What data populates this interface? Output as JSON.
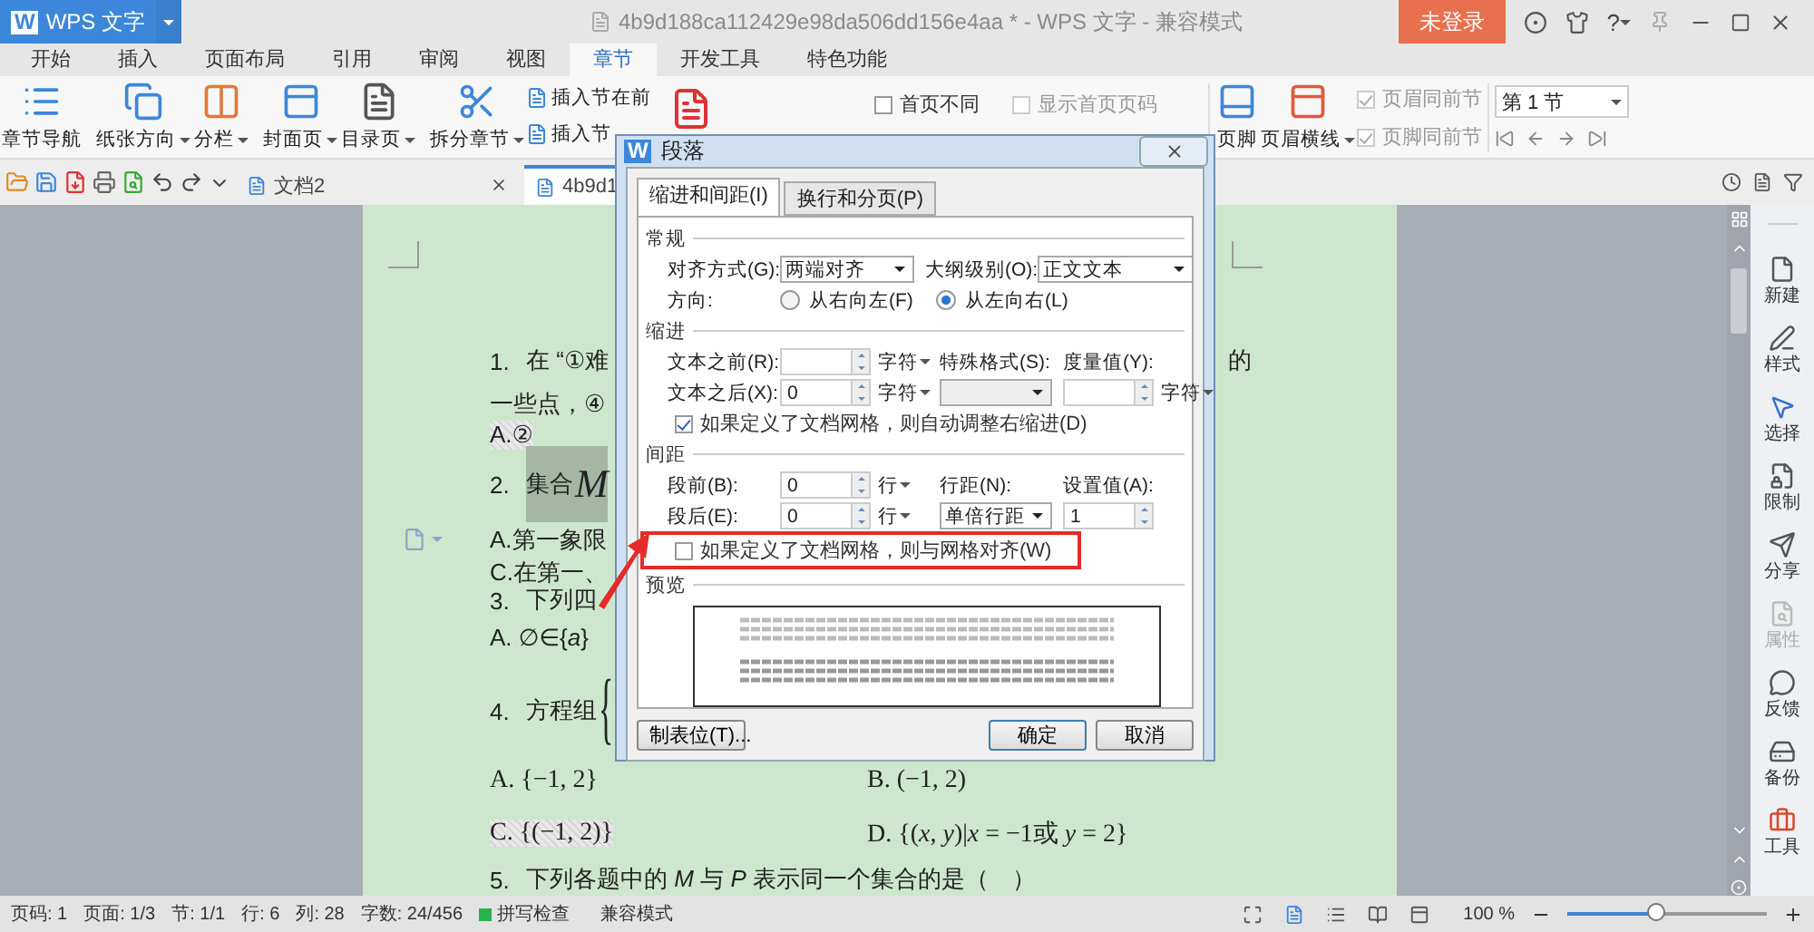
{
  "title_bar": {
    "logo": "W",
    "app": "WPS 文字",
    "title": "4b9d188ca112429e98da506dd156e4aa * - WPS 文字 - 兼容模式",
    "login": "未登录",
    "help": "?"
  },
  "menu_tabs": [
    {
      "label": "开始",
      "selected": false
    },
    {
      "label": "插入",
      "selected": false
    },
    {
      "label": "页面布局",
      "selected": false
    },
    {
      "label": "引用",
      "selected": false
    },
    {
      "label": "审阅",
      "selected": false
    },
    {
      "label": "视图",
      "selected": false
    },
    {
      "label": "章节",
      "selected": true
    },
    {
      "label": "开发工具",
      "selected": false
    },
    {
      "label": "特色功能",
      "selected": false
    }
  ],
  "ribbon": {
    "buttons": [
      {
        "label": "章节导航",
        "dropdown": false
      },
      {
        "label": "纸张方向",
        "dropdown": true
      },
      {
        "label": "分栏",
        "dropdown": true
      },
      {
        "label": "封面页",
        "dropdown": true
      },
      {
        "label": "目录页",
        "dropdown": true
      },
      {
        "label": "拆分章节",
        "dropdown": true
      }
    ],
    "section_buttons": [
      "插入节在前",
      "插入节"
    ],
    "page_checks": [
      {
        "label": "首页不同",
        "checked": false,
        "disabled": false
      },
      {
        "label": "显示首页页码",
        "checked": false,
        "disabled": true
      }
    ],
    "header_buttons": [
      {
        "label": "页脚",
        "dropdown": false
      },
      {
        "label": "页眉横线",
        "dropdown": true
      }
    ],
    "link_checks": [
      {
        "label": "页眉同前节",
        "checked": true,
        "disabled": true
      },
      {
        "label": "页脚同前节",
        "checked": true,
        "disabled": true
      }
    ],
    "section_select": "第 1 节"
  },
  "doc_tabs": [
    {
      "label": "文档2",
      "selected": false
    },
    {
      "label": "4b9d1",
      "selected": true
    }
  ],
  "document": {
    "lines": [
      {
        "kind": "question",
        "num": "1.",
        "text": "在 “①难",
        "tail": "的"
      },
      {
        "kind": "text",
        "text": "一些点，④",
        "shaded": false
      },
      {
        "kind": "text",
        "text": "A.②",
        "shaded": true
      },
      {
        "kind": "formula",
        "num": "2.",
        "text": "集合",
        "math": "M",
        "shaded": true
      },
      {
        "kind": "text",
        "text": "A.第一象限",
        "shaded": false
      },
      {
        "kind": "text",
        "text": "C.在第一、",
        "shaded": false
      },
      {
        "kind": "question",
        "num": "3.",
        "text": "下列四"
      },
      {
        "kind": "text",
        "text": "A. ∅∈{*a*}",
        "shaded": false
      },
      {
        "kind": "formula",
        "num": "4.",
        "text": "方程组",
        "math": "{",
        "shaded": false
      },
      {
        "kind": "options",
        "items": [
          {
            "text": "A. {−1, 2}",
            "shaded": false
          },
          {
            "text": "B. (−1, 2)",
            "shaded": false
          }
        ]
      },
      {
        "kind": "options",
        "items": [
          {
            "text": "C. {(−1, 2)}",
            "shaded": true
          },
          {
            "text": "D. {(*x*, *y*)|*x* = −1或 *y* = 2}",
            "shaded": false
          }
        ]
      },
      {
        "kind": "question",
        "num": "5.",
        "text": "下列各题中的 *M* 与 *P* 表示同一个集合的是（　）"
      }
    ]
  },
  "dialog": {
    "logo": "W",
    "title": "段落",
    "tabs": [
      {
        "label": "缩进和间距(I)",
        "selected": true
      },
      {
        "label": "换行和分页(P)",
        "selected": false
      }
    ],
    "general": {
      "heading": "常规",
      "alignment": {
        "label": "对齐方式(G):",
        "value": "两端对齐"
      },
      "outline": {
        "label": "大纲级别(O):",
        "value": "正文文本"
      },
      "direction": {
        "label": "方向:",
        "options": [
          {
            "label": "从右向左(F)",
            "selected": false
          },
          {
            "label": "从左向右(L)",
            "selected": true
          }
        ]
      }
    },
    "indent": {
      "heading": "缩进",
      "before": {
        "label": "文本之前(R):",
        "unit": "字符"
      },
      "after": {
        "label": "文本之后(X):",
        "value": "0",
        "unit": "字符"
      },
      "special": {
        "label": "特殊格式(S):"
      },
      "measure": {
        "label": "度量值(Y):",
        "unit": "字符"
      },
      "auto_check": {
        "label": "如果定义了文档网格，则自动调整右缩进(D)",
        "checked": true
      }
    },
    "spacing": {
      "heading": "间距",
      "before": {
        "label": "段前(B):",
        "value": "0",
        "unit": "行"
      },
      "after": {
        "label": "段后(E):",
        "value": "0",
        "unit": "行"
      },
      "line": {
        "label": "行距(N):",
        "value": "单倍行距"
      },
      "setting": {
        "label": "设置值(A):",
        "value": "1"
      },
      "grid_check": {
        "label": "如果定义了文档网格，则与网格对齐(W)",
        "checked": false,
        "highlighted": true
      }
    },
    "preview": {
      "heading": "预览"
    },
    "buttons": [
      {
        "label": "制表位(T)...",
        "primary": false
      },
      {
        "label": "确定",
        "primary": true
      },
      {
        "label": "取消",
        "primary": false
      }
    ]
  },
  "sidebar": [
    {
      "label": "新建",
      "disabled": false
    },
    {
      "label": "样式",
      "disabled": false
    },
    {
      "label": "选择",
      "disabled": false
    },
    {
      "label": "限制",
      "disabled": false
    },
    {
      "label": "分享",
      "disabled": false
    },
    {
      "label": "属性",
      "disabled": true
    },
    {
      "label": "反馈",
      "disabled": false
    },
    {
      "label": "备份",
      "disabled": false
    },
    {
      "label": "工具",
      "disabled": false
    }
  ],
  "status_bar": {
    "items": [
      "页码: 1",
      "页面: 1/3",
      "节: 1/1",
      "行: 6",
      "列: 28",
      "字数: 24/456"
    ],
    "spell_check": {
      "label": "拼写检查",
      "on": true
    },
    "mode": "兼容模式",
    "zoom": "100 %",
    "zoom_level": {
      "level": 0.45
    }
  }
}
